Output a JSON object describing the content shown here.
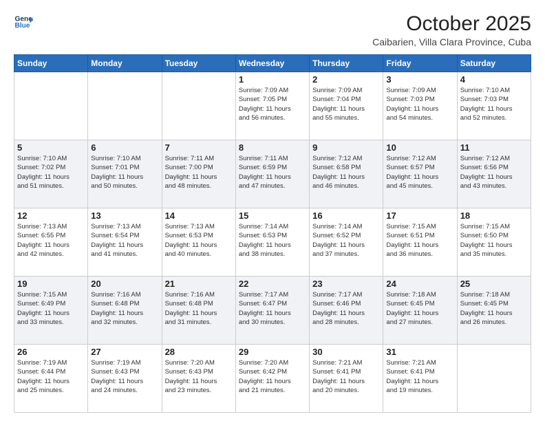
{
  "header": {
    "logo_line1": "General",
    "logo_line2": "Blue",
    "month": "October 2025",
    "location": "Caibarien, Villa Clara Province, Cuba"
  },
  "weekdays": [
    "Sunday",
    "Monday",
    "Tuesday",
    "Wednesday",
    "Thursday",
    "Friday",
    "Saturday"
  ],
  "weeks": [
    [
      {
        "day": "",
        "info": ""
      },
      {
        "day": "",
        "info": ""
      },
      {
        "day": "",
        "info": ""
      },
      {
        "day": "1",
        "info": "Sunrise: 7:09 AM\nSunset: 7:05 PM\nDaylight: 11 hours\nand 56 minutes."
      },
      {
        "day": "2",
        "info": "Sunrise: 7:09 AM\nSunset: 7:04 PM\nDaylight: 11 hours\nand 55 minutes."
      },
      {
        "day": "3",
        "info": "Sunrise: 7:09 AM\nSunset: 7:03 PM\nDaylight: 11 hours\nand 54 minutes."
      },
      {
        "day": "4",
        "info": "Sunrise: 7:10 AM\nSunset: 7:03 PM\nDaylight: 11 hours\nand 52 minutes."
      }
    ],
    [
      {
        "day": "5",
        "info": "Sunrise: 7:10 AM\nSunset: 7:02 PM\nDaylight: 11 hours\nand 51 minutes."
      },
      {
        "day": "6",
        "info": "Sunrise: 7:10 AM\nSunset: 7:01 PM\nDaylight: 11 hours\nand 50 minutes."
      },
      {
        "day": "7",
        "info": "Sunrise: 7:11 AM\nSunset: 7:00 PM\nDaylight: 11 hours\nand 48 minutes."
      },
      {
        "day": "8",
        "info": "Sunrise: 7:11 AM\nSunset: 6:59 PM\nDaylight: 11 hours\nand 47 minutes."
      },
      {
        "day": "9",
        "info": "Sunrise: 7:12 AM\nSunset: 6:58 PM\nDaylight: 11 hours\nand 46 minutes."
      },
      {
        "day": "10",
        "info": "Sunrise: 7:12 AM\nSunset: 6:57 PM\nDaylight: 11 hours\nand 45 minutes."
      },
      {
        "day": "11",
        "info": "Sunrise: 7:12 AM\nSunset: 6:56 PM\nDaylight: 11 hours\nand 43 minutes."
      }
    ],
    [
      {
        "day": "12",
        "info": "Sunrise: 7:13 AM\nSunset: 6:55 PM\nDaylight: 11 hours\nand 42 minutes."
      },
      {
        "day": "13",
        "info": "Sunrise: 7:13 AM\nSunset: 6:54 PM\nDaylight: 11 hours\nand 41 minutes."
      },
      {
        "day": "14",
        "info": "Sunrise: 7:13 AM\nSunset: 6:53 PM\nDaylight: 11 hours\nand 40 minutes."
      },
      {
        "day": "15",
        "info": "Sunrise: 7:14 AM\nSunset: 6:53 PM\nDaylight: 11 hours\nand 38 minutes."
      },
      {
        "day": "16",
        "info": "Sunrise: 7:14 AM\nSunset: 6:52 PM\nDaylight: 11 hours\nand 37 minutes."
      },
      {
        "day": "17",
        "info": "Sunrise: 7:15 AM\nSunset: 6:51 PM\nDaylight: 11 hours\nand 36 minutes."
      },
      {
        "day": "18",
        "info": "Sunrise: 7:15 AM\nSunset: 6:50 PM\nDaylight: 11 hours\nand 35 minutes."
      }
    ],
    [
      {
        "day": "19",
        "info": "Sunrise: 7:15 AM\nSunset: 6:49 PM\nDaylight: 11 hours\nand 33 minutes."
      },
      {
        "day": "20",
        "info": "Sunrise: 7:16 AM\nSunset: 6:48 PM\nDaylight: 11 hours\nand 32 minutes."
      },
      {
        "day": "21",
        "info": "Sunrise: 7:16 AM\nSunset: 6:48 PM\nDaylight: 11 hours\nand 31 minutes."
      },
      {
        "day": "22",
        "info": "Sunrise: 7:17 AM\nSunset: 6:47 PM\nDaylight: 11 hours\nand 30 minutes."
      },
      {
        "day": "23",
        "info": "Sunrise: 7:17 AM\nSunset: 6:46 PM\nDaylight: 11 hours\nand 28 minutes."
      },
      {
        "day": "24",
        "info": "Sunrise: 7:18 AM\nSunset: 6:45 PM\nDaylight: 11 hours\nand 27 minutes."
      },
      {
        "day": "25",
        "info": "Sunrise: 7:18 AM\nSunset: 6:45 PM\nDaylight: 11 hours\nand 26 minutes."
      }
    ],
    [
      {
        "day": "26",
        "info": "Sunrise: 7:19 AM\nSunset: 6:44 PM\nDaylight: 11 hours\nand 25 minutes."
      },
      {
        "day": "27",
        "info": "Sunrise: 7:19 AM\nSunset: 6:43 PM\nDaylight: 11 hours\nand 24 minutes."
      },
      {
        "day": "28",
        "info": "Sunrise: 7:20 AM\nSunset: 6:43 PM\nDaylight: 11 hours\nand 23 minutes."
      },
      {
        "day": "29",
        "info": "Sunrise: 7:20 AM\nSunset: 6:42 PM\nDaylight: 11 hours\nand 21 minutes."
      },
      {
        "day": "30",
        "info": "Sunrise: 7:21 AM\nSunset: 6:41 PM\nDaylight: 11 hours\nand 20 minutes."
      },
      {
        "day": "31",
        "info": "Sunrise: 7:21 AM\nSunset: 6:41 PM\nDaylight: 11 hours\nand 19 minutes."
      },
      {
        "day": "",
        "info": ""
      }
    ]
  ]
}
